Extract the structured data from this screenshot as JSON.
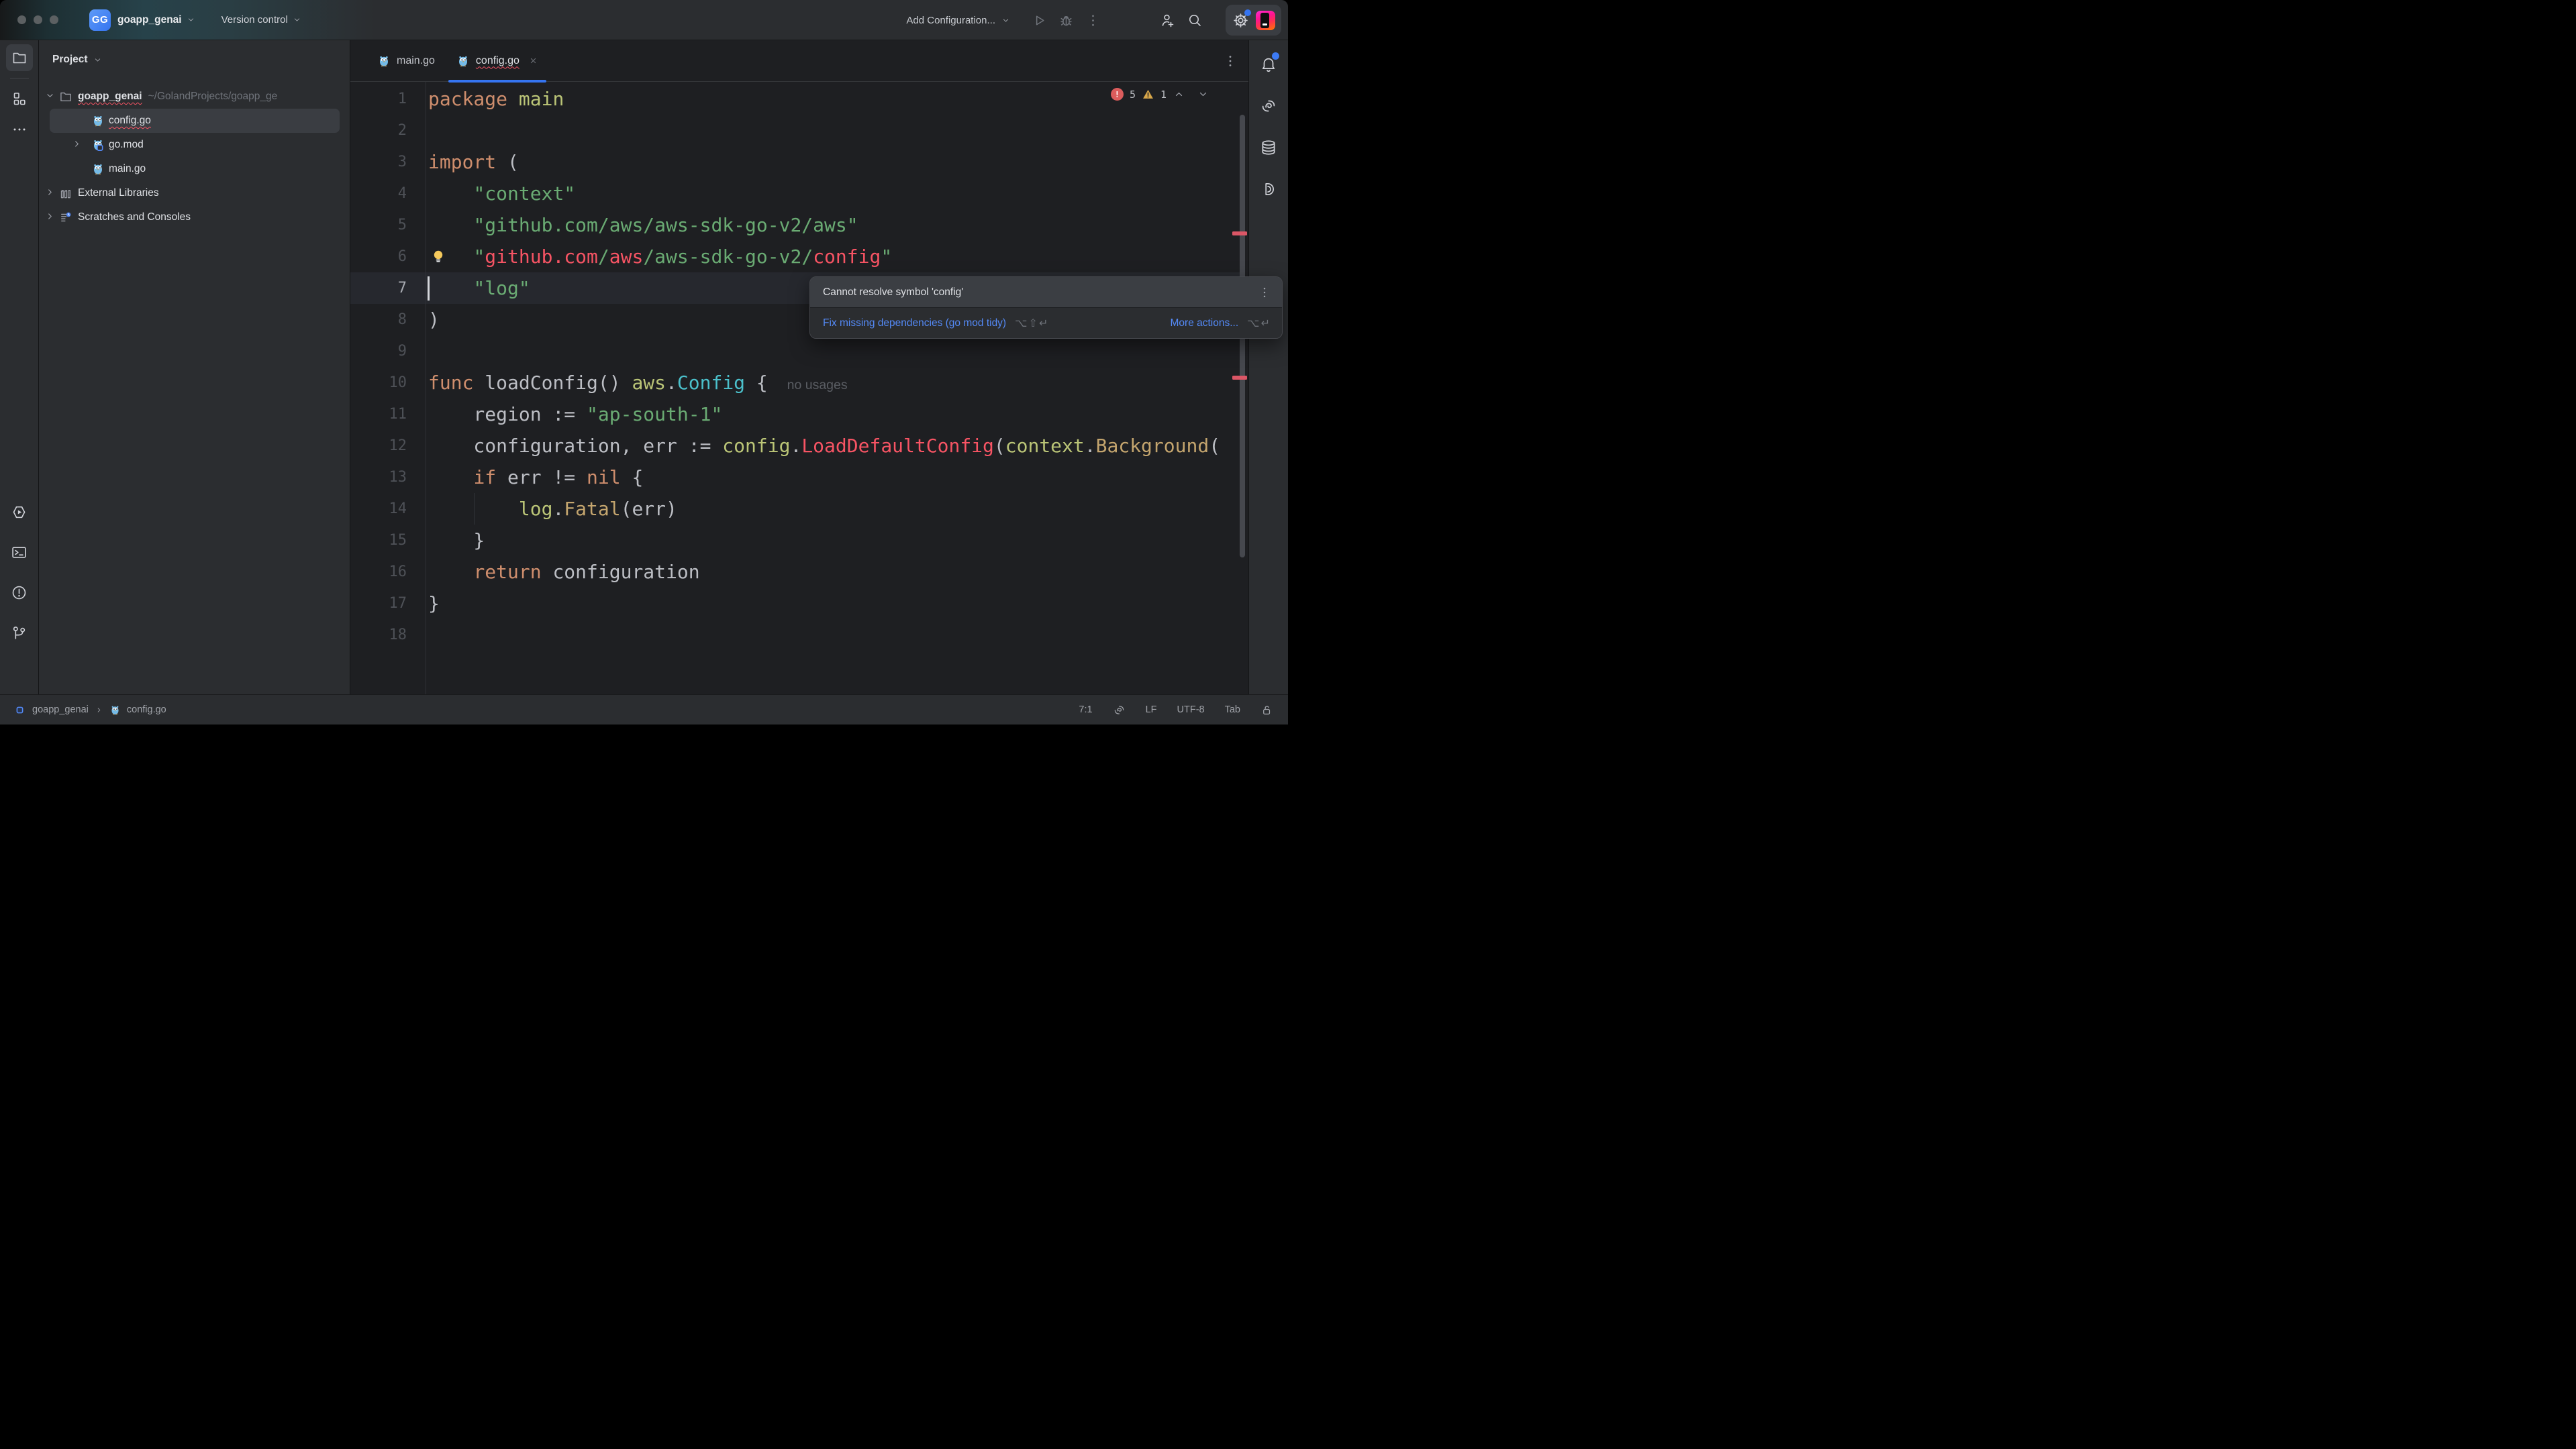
{
  "titlebar": {
    "project_badge": "GG",
    "project_name": "goapp_genai",
    "version_control_label": "Version control",
    "add_configuration_label": "Add Configuration..."
  },
  "left_strip": {
    "top_icons": [
      {
        "name": "folder-icon",
        "active": true
      },
      {
        "name": "structure-icon",
        "active": false
      },
      {
        "name": "more-horizontal-icon",
        "active": false
      }
    ],
    "bottom_icons": [
      {
        "name": "run-hexagon-icon"
      },
      {
        "name": "terminal-icon"
      },
      {
        "name": "problems-icon"
      },
      {
        "name": "git-branch-icon"
      }
    ]
  },
  "project_panel": {
    "header": "Project",
    "tree": [
      {
        "label": "goapp_genai",
        "path": "~/GolandProjects/goapp_ge",
        "icon": "folder-icon",
        "chevron": "down",
        "bold": true,
        "squiggle": true,
        "indent": 0
      },
      {
        "label": "config.go",
        "icon": "go-file-icon",
        "selected": true,
        "squiggle": true,
        "indent": 2
      },
      {
        "label": "go.mod",
        "icon": "go-mod-icon",
        "chevron": "right",
        "indent": 1
      },
      {
        "label": "main.go",
        "icon": "go-file-icon",
        "indent": 2
      },
      {
        "label": "External Libraries",
        "icon": "libraries-icon",
        "chevron": "right",
        "indent": 0
      },
      {
        "label": "Scratches and Consoles",
        "icon": "scratches-icon",
        "chevron": "right",
        "indent": 0
      }
    ]
  },
  "editor": {
    "tabs": [
      {
        "label": "main.go",
        "icon": "go-file-icon",
        "active": false,
        "closable": false,
        "squiggle": false
      },
      {
        "label": "config.go",
        "icon": "go-file-icon",
        "active": true,
        "closable": true,
        "squiggle": true
      }
    ],
    "inspections": {
      "errors": "5",
      "warnings": "1"
    },
    "caret_line": 7,
    "lightbulb_line": 6,
    "lines": [
      {
        "n": 1,
        "spans": [
          [
            "kw",
            "package"
          ],
          [
            "tx",
            " "
          ],
          [
            "pk",
            "main"
          ]
        ]
      },
      {
        "n": 2,
        "spans": []
      },
      {
        "n": 3,
        "spans": [
          [
            "kw",
            "import"
          ],
          [
            "tx",
            " ("
          ]
        ]
      },
      {
        "n": 4,
        "spans": [
          [
            "tx",
            "    "
          ],
          [
            "st",
            "\"context\""
          ]
        ]
      },
      {
        "n": 5,
        "spans": [
          [
            "tx",
            "    "
          ],
          [
            "st",
            "\"github.com/aws/aws-sdk-go-v2/aws\""
          ]
        ]
      },
      {
        "n": 6,
        "spans": [
          [
            "tx",
            "    "
          ],
          [
            "st",
            "\""
          ],
          [
            "er",
            "github.com"
          ],
          [
            "st",
            "/"
          ],
          [
            "er",
            "aws"
          ],
          [
            "st",
            "/aws-sdk-go-v2/"
          ],
          [
            "er",
            "config"
          ],
          [
            "st",
            "\""
          ]
        ]
      },
      {
        "n": 7,
        "spans": [
          [
            "tx",
            "    "
          ],
          [
            "st",
            "\"log\""
          ]
        ]
      },
      {
        "n": 8,
        "spans": [
          [
            "tx",
            ")"
          ]
        ]
      },
      {
        "n": 9,
        "spans": []
      },
      {
        "n": 10,
        "spans": [
          [
            "kw",
            "func"
          ],
          [
            "tx",
            " loadConfig() "
          ],
          [
            "pk",
            "aws"
          ],
          [
            "tx",
            "."
          ],
          [
            "ty",
            "Config"
          ],
          [
            "tx",
            " { "
          ],
          [
            "in",
            "no usages"
          ]
        ]
      },
      {
        "n": 11,
        "spans": [
          [
            "tx",
            "    region := "
          ],
          [
            "st",
            "\"ap-south-1\""
          ]
        ]
      },
      {
        "n": 12,
        "spans": [
          [
            "tx",
            "    configuration, err := "
          ],
          [
            "pk",
            "config"
          ],
          [
            "tx",
            "."
          ],
          [
            "er",
            "LoadDefaultConfig"
          ],
          [
            "tx",
            "("
          ],
          [
            "pk",
            "context"
          ],
          [
            "tx",
            "."
          ],
          [
            "fn",
            "Background"
          ],
          [
            "tx",
            "("
          ]
        ]
      },
      {
        "n": 13,
        "spans": [
          [
            "tx",
            "    "
          ],
          [
            "kw",
            "if"
          ],
          [
            "tx",
            " err != "
          ],
          [
            "kw",
            "nil"
          ],
          [
            "tx",
            " {"
          ]
        ]
      },
      {
        "n": 14,
        "spans": [
          [
            "tx",
            "        "
          ],
          [
            "pk",
            "log"
          ],
          [
            "tx",
            "."
          ],
          [
            "fn",
            "Fatal"
          ],
          [
            "tx",
            "(err)"
          ]
        ]
      },
      {
        "n": 15,
        "spans": [
          [
            "tx",
            "    }"
          ]
        ]
      },
      {
        "n": 16,
        "spans": [
          [
            "tx",
            "    "
          ],
          [
            "kw",
            "return"
          ],
          [
            "tx",
            " configuration"
          ]
        ]
      },
      {
        "n": 17,
        "spans": [
          [
            "tx",
            "}"
          ]
        ]
      },
      {
        "n": 18,
        "spans": []
      }
    ],
    "tooltip": {
      "message": "Cannot resolve symbol 'config'",
      "fix_label": "Fix missing dependencies (go mod tidy)",
      "fix_shortcut": "⌥⇧↵",
      "more_label": "More actions...",
      "more_shortcut": "⌥↵"
    }
  },
  "right_strip": {
    "icons": [
      {
        "name": "notifications-icon",
        "badge": true
      },
      {
        "name": "ai-assistant-icon"
      },
      {
        "name": "database-icon"
      },
      {
        "name": "documentation-icon"
      }
    ]
  },
  "statusbar": {
    "breadcrumb": [
      "goapp_genai",
      "config.go"
    ],
    "caret_position": "7:1",
    "line_separator": "LF",
    "encoding": "UTF-8",
    "indent_style": "Tab"
  },
  "colors": {
    "accent_blue": "#3574F0",
    "link_blue": "#548AF7",
    "error_red": "#F75464",
    "warning_yellow": "#D8A74A",
    "string_green": "#6AAB73",
    "keyword_orange": "#CF8E6D",
    "panel_bg": "#2B2D30",
    "editor_bg": "#1E1F22"
  }
}
